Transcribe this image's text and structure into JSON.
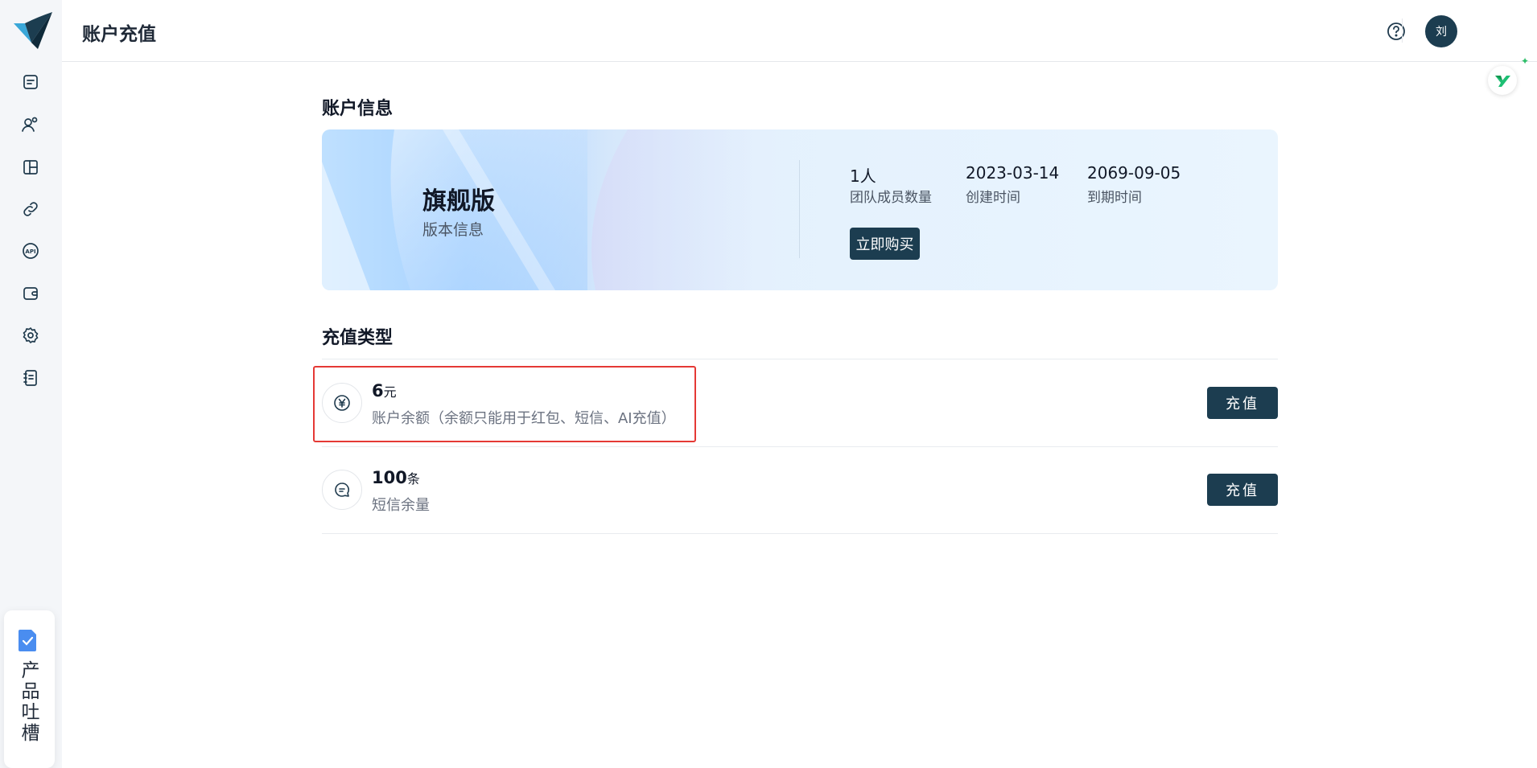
{
  "header": {
    "title": "账户充值",
    "avatar_initial": "刘"
  },
  "sidebar": {
    "items": [
      {
        "icon": "message-square-icon"
      },
      {
        "icon": "users-icon"
      },
      {
        "icon": "layout-icon"
      },
      {
        "icon": "link-icon"
      },
      {
        "icon": "api-icon"
      },
      {
        "icon": "wallet-icon"
      },
      {
        "icon": "settings-icon"
      },
      {
        "icon": "notebook-icon"
      }
    ],
    "feedback_label": "产品吐槽"
  },
  "account_info": {
    "section_title": "账户信息",
    "plan_name": "旗舰版",
    "plan_subtitle": "版本信息",
    "stats": [
      {
        "value": "1人",
        "label": "团队成员数量"
      },
      {
        "value": "2023-03-14",
        "label": "创建时间"
      },
      {
        "value": "2069-09-05",
        "label": "到期时间"
      }
    ],
    "buy_label": "立即购买"
  },
  "recharge": {
    "section_title": "充值类型",
    "items": [
      {
        "amount": "6",
        "unit": "元",
        "description": "账户余额（余额只能用于红包、短信、AI充值）",
        "icon": "yen-icon",
        "button": "充值"
      },
      {
        "amount": "100",
        "unit": "条",
        "description": "短信余量",
        "icon": "message-circle-icon",
        "button": "充值"
      }
    ]
  },
  "colors": {
    "primary": "#1c3d50",
    "sidebar_bg": "#f4f6f9",
    "highlight": "#e53935"
  }
}
